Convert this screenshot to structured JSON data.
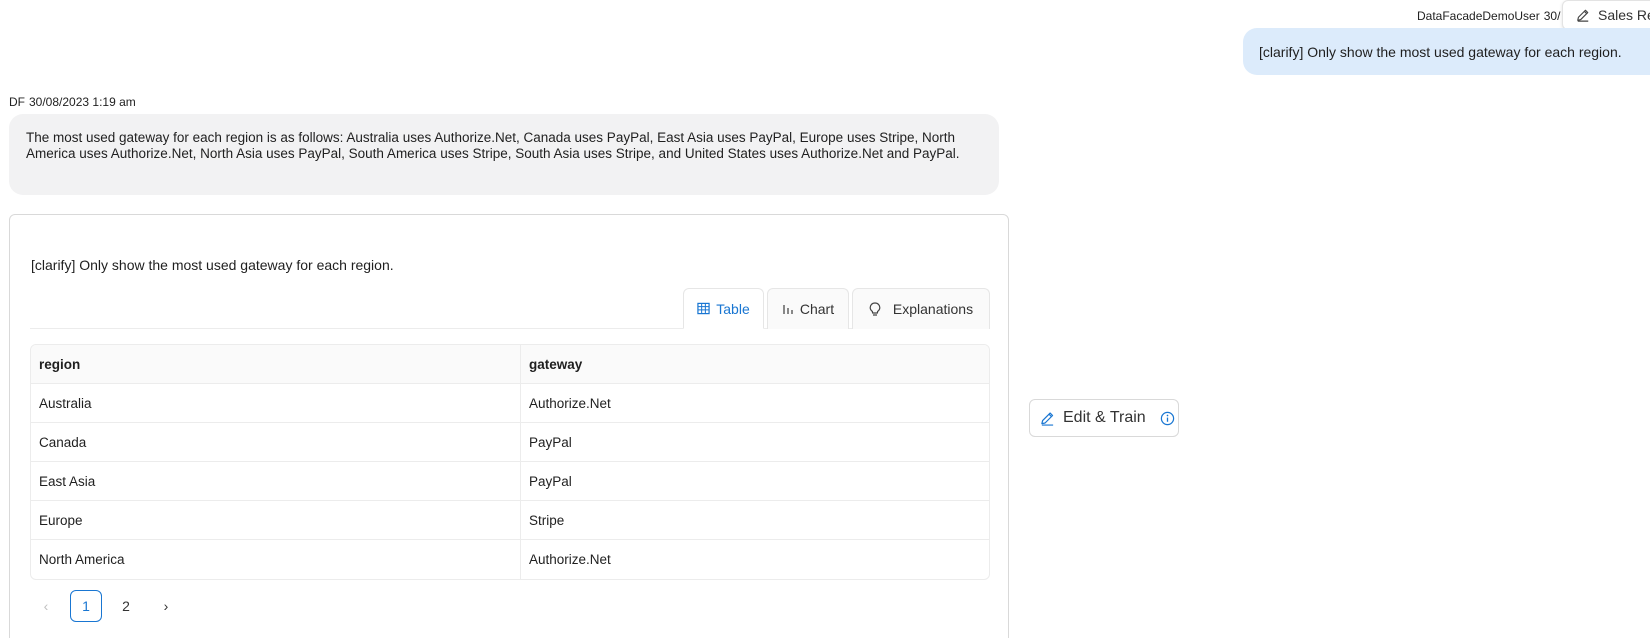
{
  "header": {
    "user_name": "DataFacadeDemoUser",
    "user_timestamp": "30/",
    "sales_chip_label": "Sales Re"
  },
  "user_message": {
    "text": "[clarify] Only show the most used gateway for each region."
  },
  "bot_message": {
    "initials": "DF",
    "timestamp": "30/08/2023 1:19 am",
    "answer": "The most used gateway for each region is as follows: Australia uses Authorize.Net, Canada uses PayPal, East Asia uses PayPal, Europe uses Stripe, North America uses Authorize.Net, North Asia uses PayPal, South America uses Stripe, South Asia uses Stripe, and United States uses Authorize.Net and PayPal."
  },
  "result": {
    "query": "[clarify] Only show the most used gateway for each region.",
    "tabs": [
      {
        "label": "Table",
        "icon": "table-icon",
        "active": true
      },
      {
        "label": "Chart",
        "icon": "bar-chart-icon",
        "active": false
      },
      {
        "label": "Explanations",
        "icon": "lightbulb-icon",
        "active": false
      }
    ],
    "table": {
      "columns": [
        "region",
        "gateway"
      ],
      "rows": [
        [
          "Australia",
          "Authorize.Net"
        ],
        [
          "Canada",
          "PayPal"
        ],
        [
          "East Asia",
          "PayPal"
        ],
        [
          "Europe",
          "Stripe"
        ],
        [
          "North America",
          "Authorize.Net"
        ]
      ]
    },
    "pagination": {
      "pages": [
        "1",
        "2"
      ],
      "current": "1",
      "prev_label": "‹",
      "next_label": "›"
    }
  },
  "edit_train": {
    "label": "Edit & Train"
  },
  "colors": {
    "accent": "#1976d2",
    "user_bubble": "#dcebfb",
    "bot_bubble": "#f2f2f3"
  }
}
